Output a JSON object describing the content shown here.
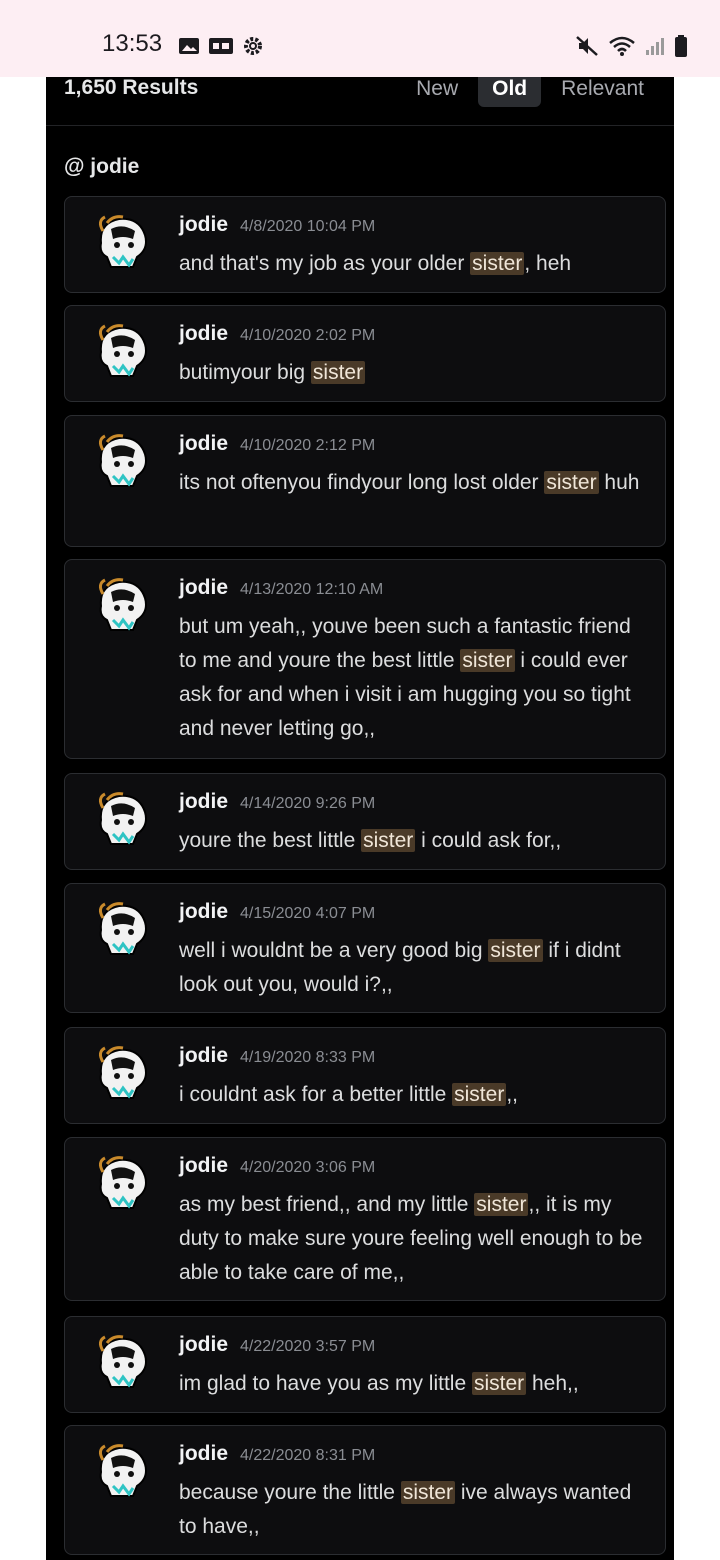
{
  "status_bar": {
    "time": "13:53",
    "left_icons": [
      "image-icon",
      "caption-icon",
      "gear-icon"
    ],
    "right_icons": [
      "mute-icon",
      "wifi-icon",
      "signal-icon",
      "battery-icon"
    ]
  },
  "search": {
    "results_count": "1,650 Results",
    "tabs": [
      {
        "label": "New",
        "active": false
      },
      {
        "label": "Old",
        "active": true
      },
      {
        "label": "Relevant",
        "active": false
      }
    ],
    "channel_label": "@ jodie"
  },
  "colors": {
    "panel_bg": "#000000",
    "card_bg": "#0d0d0f",
    "highlight_bg": "#4a3a28",
    "status_bar_bg": "#fdeef3"
  },
  "messages": [
    {
      "author": "jodie",
      "timestamp": "4/8/2020 10:04 PM",
      "parts": [
        "and that's my job as your older ",
        "sister",
        ", heh"
      ]
    },
    {
      "author": "jodie",
      "timestamp": "4/10/2020 2:02 PM",
      "parts": [
        "butimyour big ",
        "sister",
        ""
      ]
    },
    {
      "author": "jodie",
      "timestamp": "4/10/2020 2:12 PM",
      "parts": [
        "its not oftenyou findyour long lost older ",
        "sister",
        " huh"
      ]
    },
    {
      "author": "jodie",
      "timestamp": "4/13/2020 12:10 AM",
      "parts": [
        "but um yeah,, youve been such a fantastic friend to me and youre the best little ",
        "sister",
        " i could ever ask for and when i visit i am hugging you so tight and never letting go,,"
      ]
    },
    {
      "author": "jodie",
      "timestamp": "4/14/2020 9:26 PM",
      "parts": [
        "youre the best little ",
        "sister",
        " i could ask for,,"
      ]
    },
    {
      "author": "jodie",
      "timestamp": "4/15/2020 4:07 PM",
      "parts": [
        "well i wouldnt be a very good big ",
        "sister",
        " if i didnt look out you, would i?,,"
      ]
    },
    {
      "author": "jodie",
      "timestamp": "4/19/2020 8:33 PM",
      "parts": [
        "i couldnt ask for a better little ",
        "sister",
        ",,"
      ]
    },
    {
      "author": "jodie",
      "timestamp": "4/20/2020 3:06 PM",
      "parts": [
        "as my best friend,, and my little ",
        "sister",
        ",, it is my duty to make sure youre feeling well enough to be able to take care of me,,"
      ]
    },
    {
      "author": "jodie",
      "timestamp": "4/22/2020 3:57 PM",
      "parts": [
        "im glad to have you as my little ",
        "sister",
        " heh,,"
      ]
    },
    {
      "author": "jodie",
      "timestamp": "4/22/2020 8:31 PM",
      "parts": [
        "because youre the little ",
        "sister",
        " ive always wanted to have,,"
      ]
    }
  ]
}
